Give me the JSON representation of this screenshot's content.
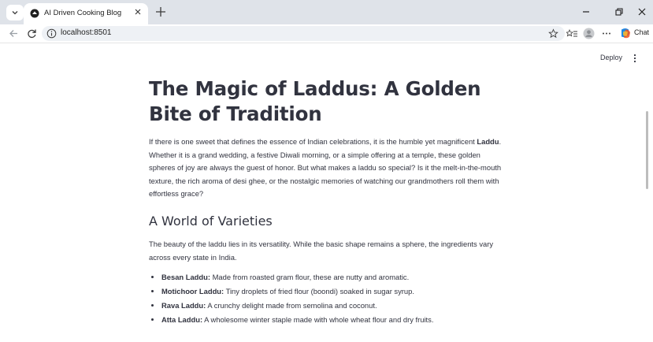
{
  "browser": {
    "tab_title": "AI Driven Cooking Blog",
    "url": "localhost:8501",
    "chat_label": "Chat"
  },
  "app": {
    "deploy_label": "Deploy"
  },
  "article": {
    "title": "The Magic of Laddus: A Golden Bite of Tradition",
    "intro_before": "If there is one sweet that defines the essence of Indian celebrations, it is the humble yet magnificent ",
    "intro_bold": "Laddu",
    "intro_after": ". Whether it is a grand wedding, a festive Diwali morning, or a simple offering at a temple, these golden spheres of joy are always the guest of honor. But what makes a laddu so special? Is it the melt-in-the-mouth texture, the rich aroma of desi ghee, or the nostalgic memories of watching our grandmothers roll them with effortless grace?",
    "section_heading": "A World of Varieties",
    "section_text": "The beauty of the laddu lies in its versatility. While the basic shape remains a sphere, the ingredients vary across every state in India.",
    "varieties": [
      {
        "name": "Besan Laddu:",
        "desc": " Made from roasted gram flour, these are nutty and aromatic."
      },
      {
        "name": "Motichoor Laddu:",
        "desc": " Tiny droplets of fried flour (boondi) soaked in sugar syrup."
      },
      {
        "name": "Rava Laddu:",
        "desc": " A crunchy delight made from semolina and coconut."
      },
      {
        "name": "Atta Laddu:",
        "desc": " A wholesome winter staple made with whole wheat flour and dry fruits."
      }
    ]
  },
  "icons": {
    "tab_menu": "chevron-down-icon",
    "favicon": "streamlit-favicon",
    "tab_close": "close-icon",
    "new_tab": "plus-icon",
    "minimize": "minimize-icon",
    "restore": "restore-icon",
    "close_window": "close-icon",
    "back": "arrow-left-icon",
    "reload": "reload-icon",
    "site_info": "info-icon",
    "bookmark": "star-icon",
    "reading_list": "reading-list-icon",
    "profile": "avatar-icon",
    "more": "ellipsis-icon",
    "copilot": "copilot-icon",
    "app_menu": "kebab-icon"
  },
  "colors": {
    "tabstrip_bg": "#dfe3e9",
    "omnibox_bg": "#eef1f5",
    "text": "#31333f"
  }
}
